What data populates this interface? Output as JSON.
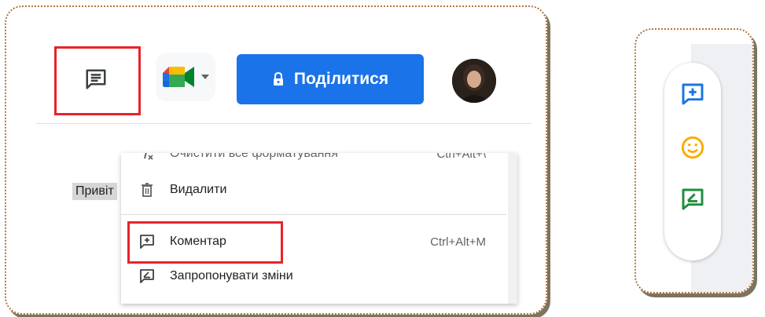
{
  "toolbar": {
    "comment_history_icon": "comment-history-icon",
    "meet_icon": "google-meet-icon",
    "share_label": "Поділитися",
    "share_icon": "lock-icon",
    "avatar_icon": "user-avatar"
  },
  "document": {
    "visible_text": "Привіт"
  },
  "context_menu": {
    "items": [
      {
        "label": "Очистити все форматування",
        "shortcut": "Ctrl+Alt+\\",
        "icon": "clear-format-icon"
      },
      {
        "label": "Видалити",
        "icon": "trash-icon"
      },
      {
        "label": "Коментар",
        "shortcut": "Ctrl+Alt+M",
        "icon": "add-comment-icon"
      },
      {
        "label": "Запропонувати зміни",
        "icon": "suggest-edits-icon"
      }
    ]
  },
  "side_actions": [
    {
      "icon": "add-comment-icon",
      "color": "#1a73e8"
    },
    {
      "icon": "emoji-icon",
      "color": "#f9ab00"
    },
    {
      "icon": "suggest-edits-icon",
      "color": "#1e8e3e"
    }
  ],
  "colors": {
    "accent": "#1a73e8",
    "highlight": "#e8232a",
    "panel_border": "#b5763c"
  }
}
